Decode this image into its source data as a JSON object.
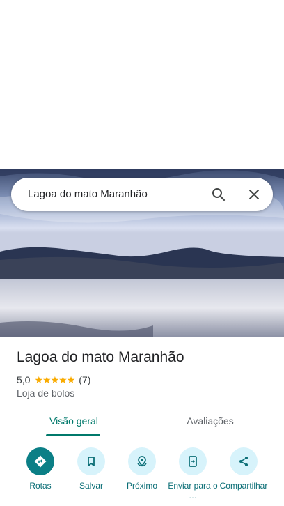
{
  "search": {
    "query": "Lagoa do mato Maranhão"
  },
  "place": {
    "name": "Lagoa do mato Maranhão",
    "rating": "5,0",
    "stars": 5,
    "review_count": "(7)",
    "category": "Loja de bolos"
  },
  "tabs": [
    {
      "label": "Visão geral",
      "active": true
    },
    {
      "label": "Avaliações",
      "active": false
    }
  ],
  "actions": [
    {
      "label": "Rotas",
      "icon": "directions-icon"
    },
    {
      "label": "Salvar",
      "icon": "bookmark-icon"
    },
    {
      "label": "Próximo",
      "icon": "nearby-icon"
    },
    {
      "label": "Enviar para o …",
      "icon": "send-to-phone-icon"
    },
    {
      "label": "Compartilhar",
      "icon": "share-icon"
    }
  ],
  "colors": {
    "accent": "#00796b",
    "action_bg": "#d7f3fb",
    "primary_action": "#0b7f86",
    "star": "#f9ab00"
  }
}
